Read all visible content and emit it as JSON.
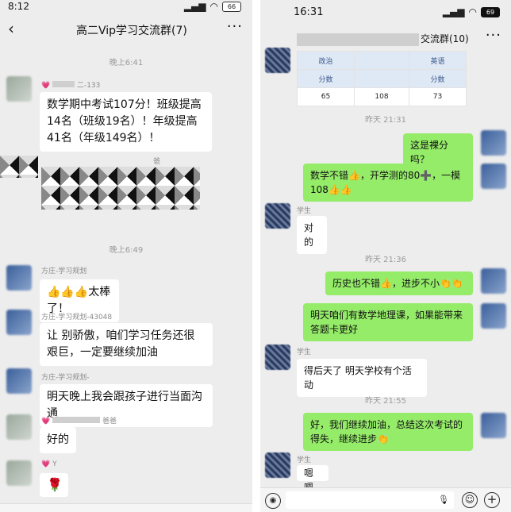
{
  "left": {
    "status": {
      "time": "8:12",
      "battery": "66"
    },
    "title": "高二Vip学习交流群(7)",
    "messages": [
      {
        "time": "晚上6:41"
      },
      {
        "sender": "二-133",
        "text": "数学期中考试107分！班级提高14名（班级19名）！年级提高41名（年级149名）！"
      },
      {
        "sender": "爸"
      },
      {
        "time": "晚上6:49"
      },
      {
        "sender": "方庄-学习规划",
        "text": "👍👍👍太棒了！"
      },
      {
        "sender": "方庄-学习规划-43048",
        "text": "让 别骄傲，咱们学习任务还很艰巨，一定要继续加油"
      },
      {
        "sender": "方庄-学习规划-",
        "text": "明天晚上我会跟孩子进行当面沟通"
      },
      {
        "sender": "爸爸",
        "text": "好的"
      },
      {
        "sender": "Y",
        "text": "🌹"
      }
    ]
  },
  "right": {
    "status": {
      "time": "16:31",
      "battery": "69"
    },
    "title": "交流群(10)",
    "table": {
      "headers": [
        "政治",
        "",
        "英语"
      ],
      "row1": [
        "分数",
        "",
        "分数"
      ],
      "row2": [
        "65",
        "108",
        "73"
      ]
    },
    "messages": [
      {
        "time": "昨天 21:31"
      },
      {
        "text": "这是裸分吗？"
      },
      {
        "text": "数学不错👍，开学测的80➕，一模108👍👍"
      },
      {
        "sender": "学生",
        "text": "对的"
      },
      {
        "time": "昨天 21:36"
      },
      {
        "text": "历史也不错👍，进步不小👏👏"
      },
      {
        "text": "明天咱们有数学地理课，如果能带来答题卡更好"
      },
      {
        "sender": "学生",
        "text": "得后天了 明天学校有个活动"
      },
      {
        "time": "昨天 21:55"
      },
      {
        "text": "好，我们继续加油，总结这次考试的得失，继续进步👏"
      },
      {
        "sender": "学生",
        "text": "嗯嗯"
      }
    ]
  }
}
